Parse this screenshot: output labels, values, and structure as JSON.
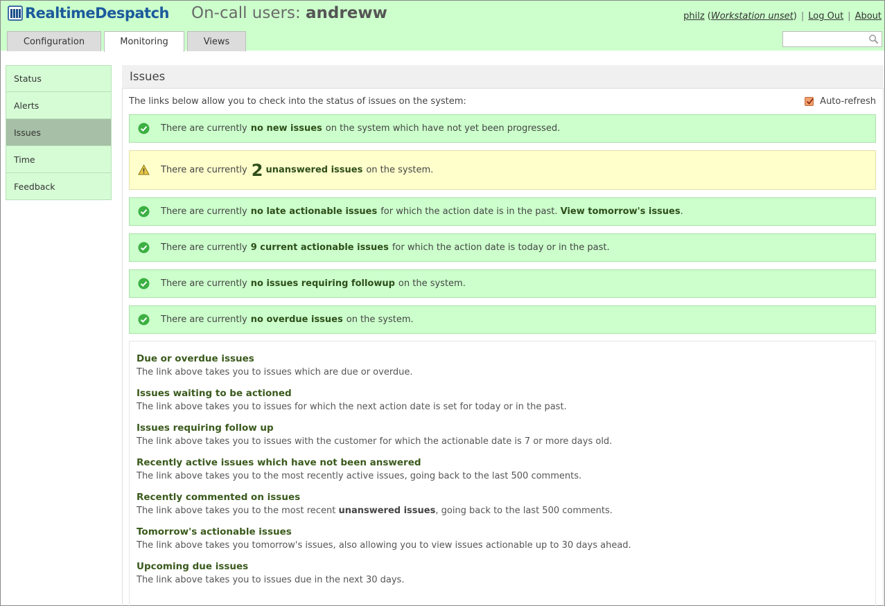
{
  "header": {
    "logo_part1": "Realtime",
    "logo_part2": "Despatch",
    "title_prefix": "On-call users:",
    "title_user": "andreww",
    "user": "philz",
    "workstation": "Workstation unset",
    "logout": "Log Out",
    "about": "About",
    "search_placeholder": ""
  },
  "tabs": [
    {
      "label": "Configuration",
      "active": false
    },
    {
      "label": "Monitoring",
      "active": true
    },
    {
      "label": "Views",
      "active": false
    }
  ],
  "sidebar": {
    "items": [
      {
        "label": "Status"
      },
      {
        "label": "Alerts"
      },
      {
        "label": "Issues",
        "active": true
      },
      {
        "label": "Time"
      },
      {
        "label": "Feedback"
      }
    ]
  },
  "main": {
    "heading": "Issues",
    "intro": "The links below allow you to check into the status of issues on the system:",
    "autorefresh_label": "Auto-refresh",
    "autorefresh_checked": true,
    "messages": [
      {
        "pre": "There are currently",
        "bold": "no new issues",
        "post": "on the system which have not yet been progressed.",
        "status": "ok"
      },
      {
        "pre": "There are currently",
        "count": "2",
        "bold": "unanswered issues",
        "post": "on the system.",
        "status": "warning"
      },
      {
        "pre": "There are currently",
        "bold": "no late actionable issues",
        "post": "for which the action date is in the past.",
        "link": "View tomorrow's issues",
        "status": "ok"
      },
      {
        "pre": "There are currently",
        "bold": "9 current actionable issues",
        "post": "for which the action date is today or in the past.",
        "status": "ok"
      },
      {
        "pre": "There are currently",
        "bold": "no issues requiring followup",
        "post": "on the system.",
        "status": "ok"
      },
      {
        "pre": "There are currently",
        "bold": "no overdue issues",
        "post": "on the system.",
        "status": "ok"
      }
    ],
    "help": [
      {
        "title": "Due or overdue issues",
        "desc": "The link above takes you to issues which are due or overdue."
      },
      {
        "title": "Issues waiting to be actioned",
        "desc": "The link above takes you to issues for which the next action date is set for today or in the past."
      },
      {
        "title": "Issues requiring follow up",
        "desc": "The link above takes you to issues with the customer for which the actionable date is 7 or more days old."
      },
      {
        "title": "Recently active issues which have not been answered",
        "desc": "The link above takes you to the most recently active issues, going back to the last 500 comments."
      },
      {
        "title": "Recently commented on issues",
        "desc_pre": "The link above takes you to the most recent",
        "desc_bold": "unanswered issues",
        "desc_post": ", going back to the last 500 comments."
      },
      {
        "title": "Tomorrow's actionable issues",
        "desc": "The link above takes you tomorrow's issues, also allowing you to view issues actionable up to 30 days ahead."
      },
      {
        "title": "Upcoming due issues",
        "desc": "The link above takes you to issues due in the next 30 days."
      }
    ]
  },
  "colors": {
    "header_bg": "#ccffcc",
    "ok_bg": "#ccffcc",
    "warn_bg": "#ffffcc",
    "sidebar_active": "#a6bfa6",
    "ok_icon": "#3cb043"
  }
}
